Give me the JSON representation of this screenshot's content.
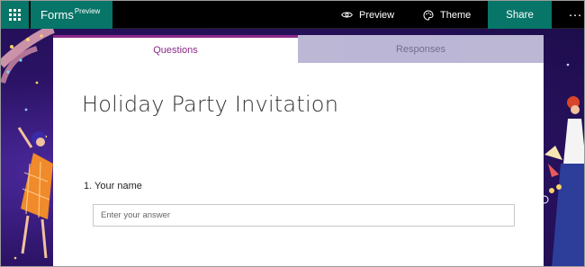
{
  "app": {
    "name": "Forms",
    "badge": "Preview"
  },
  "topbar": {
    "preview_label": "Preview",
    "theme_label": "Theme",
    "share_label": "Share",
    "more_label": "···"
  },
  "tabs": [
    {
      "label": "Questions",
      "active": true
    },
    {
      "label": "Responses",
      "active": false
    }
  ],
  "form": {
    "title": "Holiday Party Invitation",
    "questions": [
      {
        "number": "1.",
        "label": "Your name",
        "placeholder": "Enter your answer"
      }
    ]
  },
  "colors": {
    "brand": "#077568",
    "accent": "#8c2a8a",
    "background": "#2c1366"
  },
  "icons": [
    "waffle-icon",
    "eye-icon",
    "palette-icon",
    "more-icon"
  ]
}
